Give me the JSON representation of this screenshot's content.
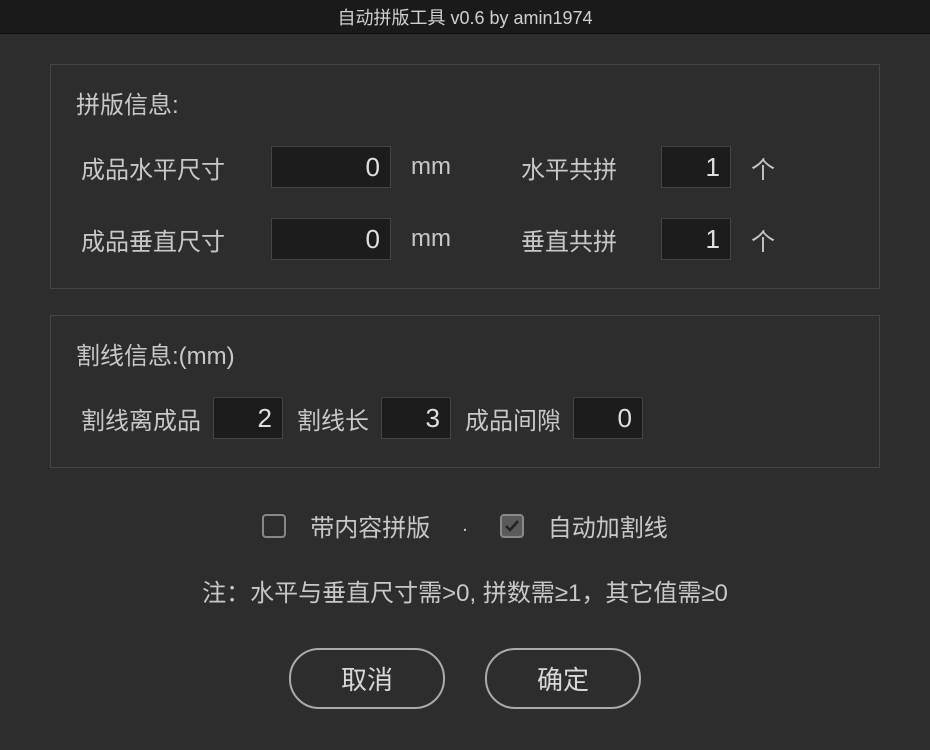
{
  "window": {
    "title": "自动拼版工具 v0.6   by amin1974"
  },
  "group1": {
    "title": "拼版信息:",
    "horizontal_size_label": "成品水平尺寸",
    "horizontal_size_value": "0",
    "horizontal_size_unit": "mm",
    "horizontal_count_label": "水平共拼",
    "horizontal_count_value": "1",
    "horizontal_count_unit": "个",
    "vertical_size_label": "成品垂直尺寸",
    "vertical_size_value": "0",
    "vertical_size_unit": "mm",
    "vertical_count_label": "垂直共拼",
    "vertical_count_value": "1",
    "vertical_count_unit": "个"
  },
  "group2": {
    "title": "割线信息:(mm)",
    "offset_label": "割线离成品",
    "offset_value": "2",
    "length_label": "割线长",
    "length_value": "3",
    "gap_label": "成品间隙",
    "gap_value": "0"
  },
  "checks": {
    "with_content_label": "带内容拼版",
    "with_content_checked": false,
    "separator": ".",
    "auto_crop_label": "自动加割线",
    "auto_crop_checked": true
  },
  "note": "注：水平与垂直尺寸需>0, 拼数需≥1，其它值需≥0",
  "buttons": {
    "cancel": "取消",
    "ok": "确定"
  }
}
